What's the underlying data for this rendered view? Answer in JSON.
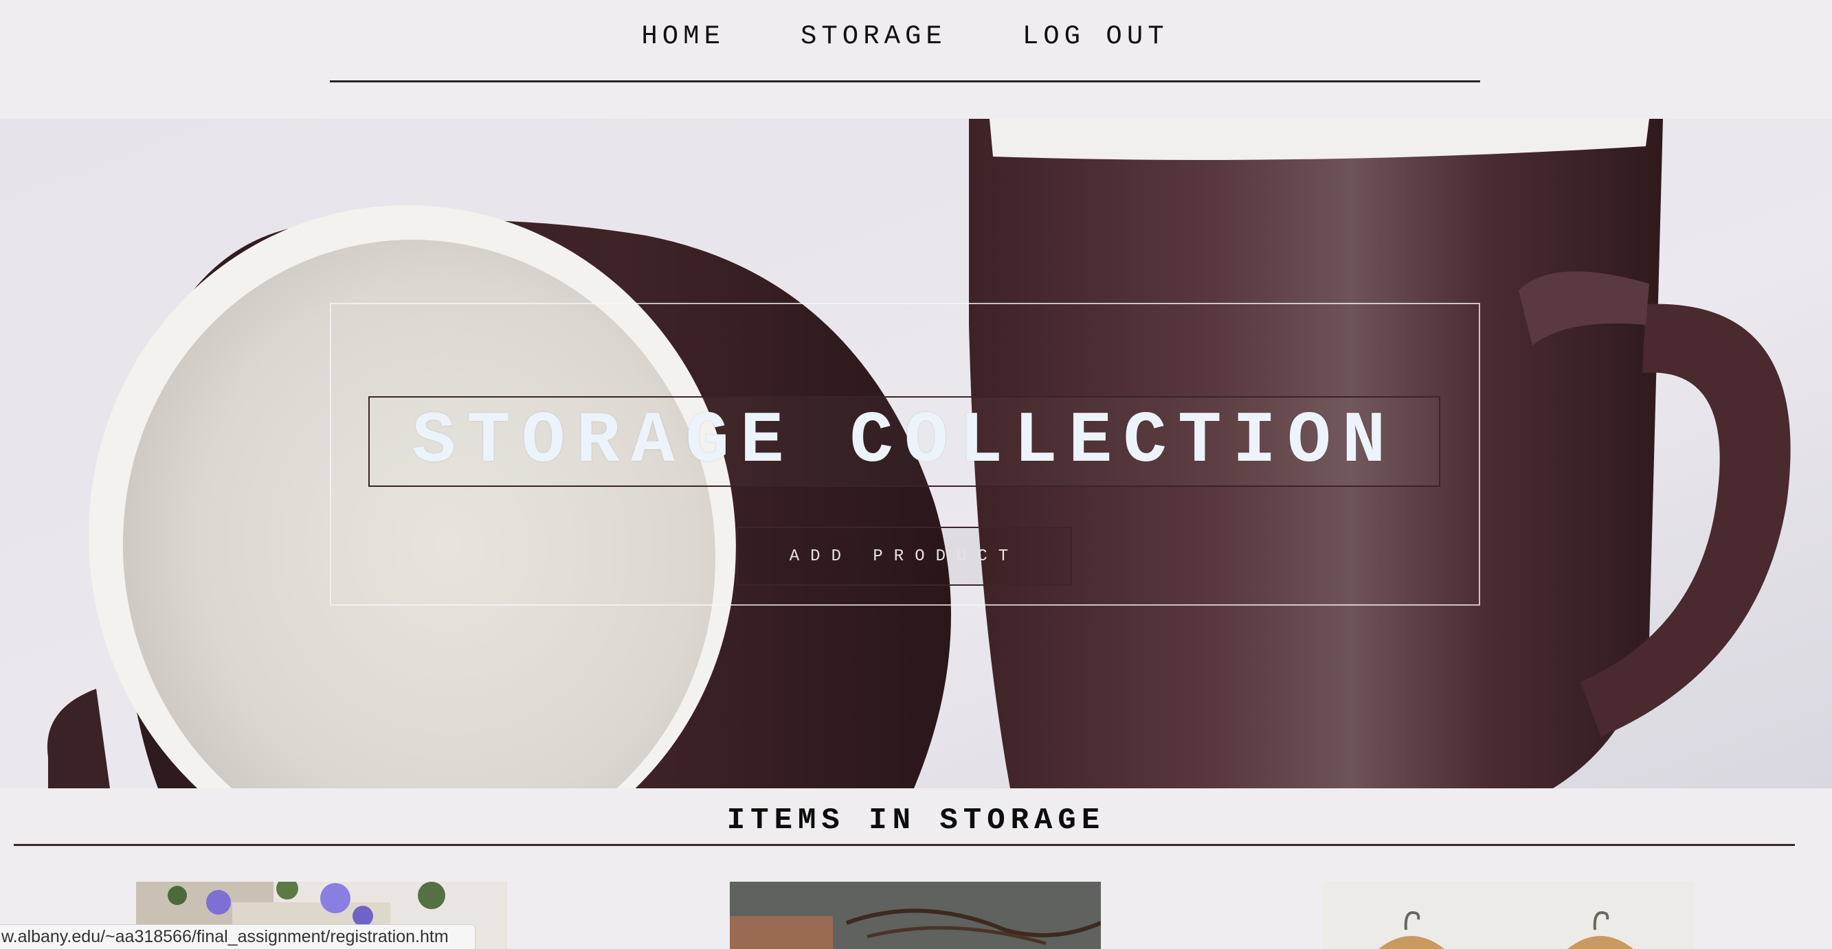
{
  "nav": {
    "items": [
      {
        "label": "HOME"
      },
      {
        "label": "STORAGE"
      },
      {
        "label": "LOG OUT"
      }
    ]
  },
  "hero": {
    "title": "STORAGE COLLECTION",
    "button_label": "ADD PRODUCT",
    "image": "two-brown-mugs-photo"
  },
  "section": {
    "title": "ITEMS IN STORAGE"
  },
  "thumbnails": [
    {
      "image": "flower-pots-photo"
    },
    {
      "image": "leather-goods-photo"
    },
    {
      "image": "wooden-hangers-photo"
    }
  ],
  "status_bar": {
    "url": "w.albany.edu/~aa318566/final_assignment/registration.htm"
  },
  "colors": {
    "background": "#efedf0",
    "mug_brown": "#4a2a2e",
    "title_text": "#edf3fb",
    "rule": "#2a2226"
  }
}
